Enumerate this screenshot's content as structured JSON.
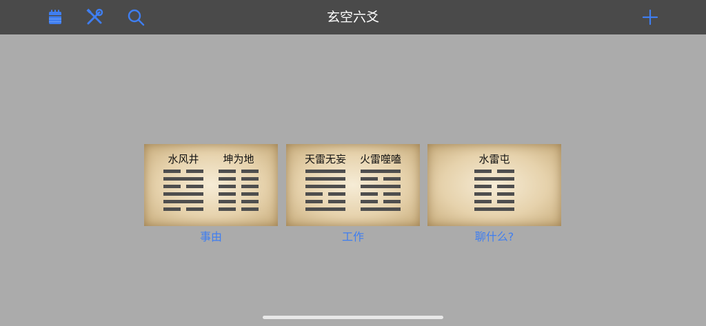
{
  "navbar": {
    "title": "玄空六爻",
    "left_icons": [
      "calendar-icon",
      "tools-icon",
      "search-icon"
    ],
    "right_icon": "plus-icon"
  },
  "accent_color": "#3f7ef0",
  "cards": [
    {
      "label": "事由",
      "hexagrams": [
        {
          "name": "水风井",
          "lines_top_to_bottom": [
            "broken",
            "solid",
            "broken",
            "solid",
            "solid",
            "broken"
          ]
        },
        {
          "name": "坤为地",
          "lines_top_to_bottom": [
            "broken",
            "broken",
            "broken",
            "broken",
            "broken",
            "broken"
          ]
        }
      ]
    },
    {
      "label": "工作",
      "hexagrams": [
        {
          "name": "天雷无妄",
          "lines_top_to_bottom": [
            "solid",
            "solid",
            "solid",
            "broken",
            "broken",
            "solid"
          ]
        },
        {
          "name": "火雷噬嗑",
          "lines_top_to_bottom": [
            "solid",
            "broken",
            "solid",
            "broken",
            "broken",
            "solid"
          ]
        }
      ]
    },
    {
      "label": "聊什么?",
      "hexagrams": [
        {
          "name": "水雷屯",
          "lines_top_to_bottom": [
            "broken",
            "solid",
            "broken",
            "broken",
            "broken",
            "solid"
          ]
        }
      ]
    }
  ]
}
